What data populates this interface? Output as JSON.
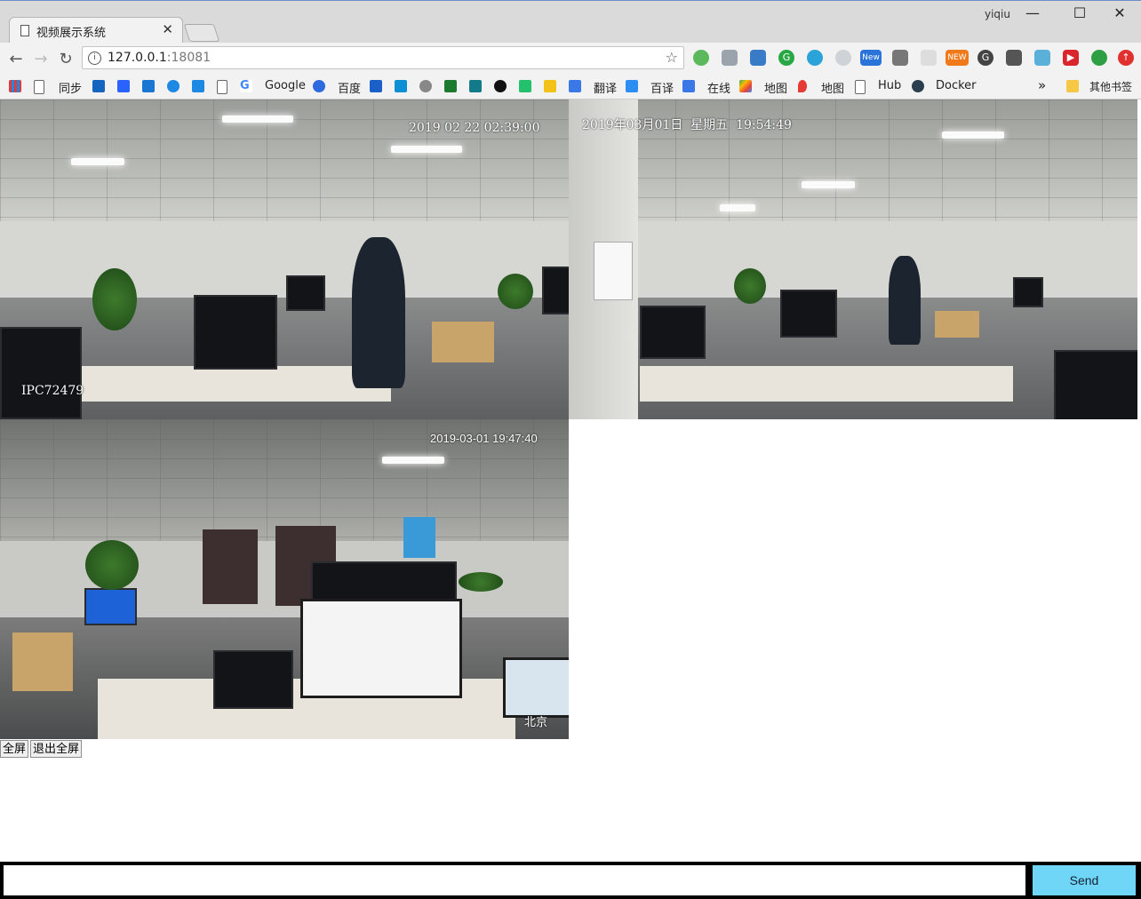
{
  "browser": {
    "tab_title": "视频展示系统",
    "user": "yiqiu",
    "url_host": "127.0.0.1",
    "url_port": ":18081"
  },
  "bookmarks": {
    "items": [
      "同步",
      "Google",
      "百度",
      "翻译",
      "百译",
      "在线",
      "地图",
      "地图",
      "Hub",
      "Docker"
    ],
    "more": "»",
    "other": "其他书签"
  },
  "extensions": [
    "New",
    "NEW"
  ],
  "cameras": [
    {
      "timestamp": "2019 02 22 02:39:00",
      "name": "IPC72479"
    },
    {
      "timestamp_date": "2019年03月01日",
      "timestamp_day": "星期五",
      "timestamp_time": "19:54:49"
    },
    {
      "timestamp": "2019-03-01 19:47:40",
      "location": "北京"
    }
  ],
  "controls": {
    "fullscreen": "全屏",
    "exit_fullscreen": "退出全屏"
  },
  "chat": {
    "input_value": "",
    "send_label": "Send"
  }
}
